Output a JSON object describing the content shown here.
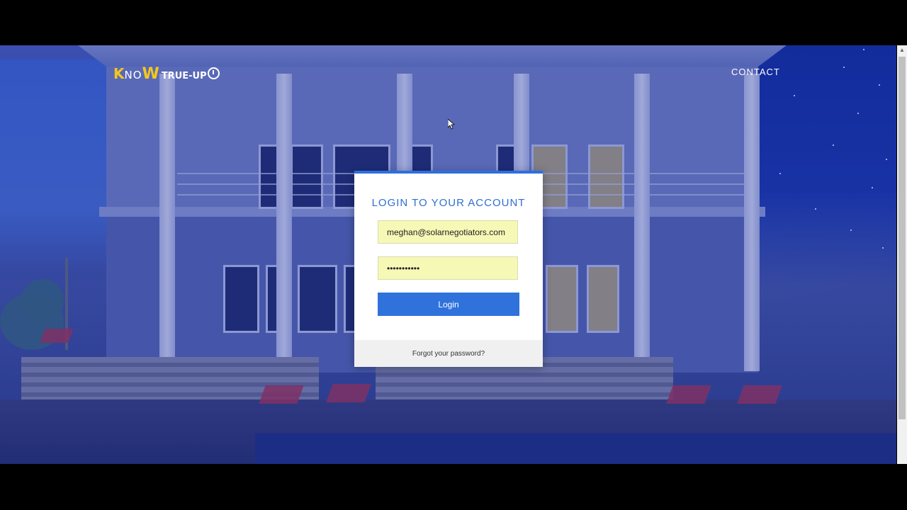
{
  "header": {
    "logo": {
      "k": "K",
      "no": "NO",
      "w": "W",
      "true_up": "TRUE-UP"
    },
    "nav": {
      "contact": "CONTACT"
    }
  },
  "login": {
    "title": "LOGIN TO YOUR ACCOUNT",
    "email": {
      "value": "meghan@solarnegotiators.com"
    },
    "password": {
      "value": "•••••••••••",
      "masked": true
    },
    "submit_label": "Login",
    "forgot_label": "Forgot your password?"
  },
  "colors": {
    "accent_blue": "#2f72dc",
    "title_blue": "#2e6fd0",
    "logo_yellow": "#f2c81c",
    "autofill_yellow": "#f6f8b6"
  },
  "icons": [
    "logo-power-icon",
    "mouse-cursor-icon",
    "scroll-up-arrow-icon"
  ]
}
